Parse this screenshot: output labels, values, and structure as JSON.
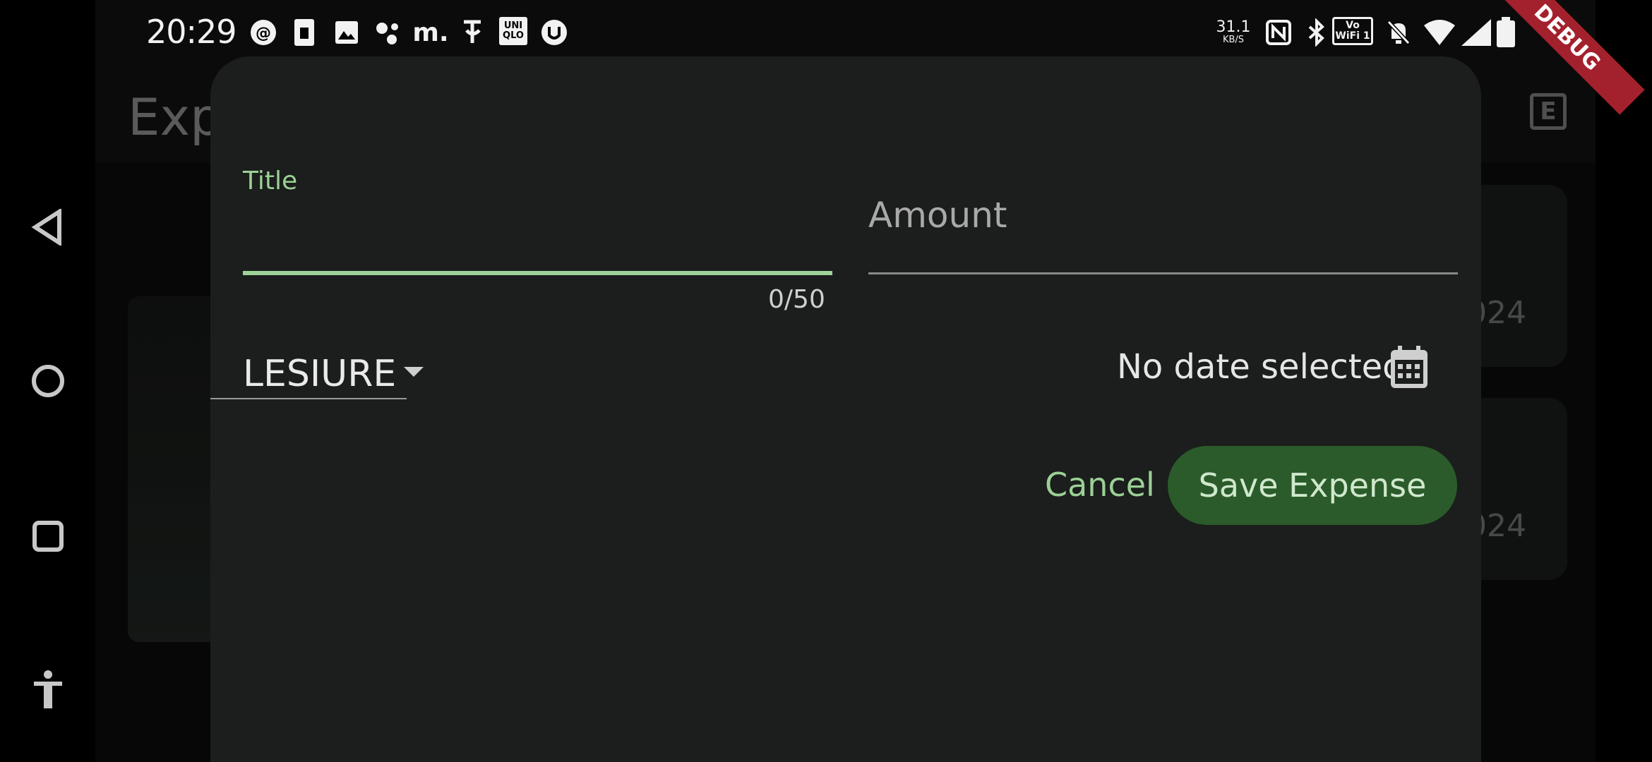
{
  "status_bar": {
    "time": "20:29",
    "net_speed_value": "31.1",
    "net_speed_unit": "KB/S",
    "m_app_label": "m.",
    "uniqlo_label": "UNI QLO",
    "vowifi_label": "Vo WiFi 1",
    "left_icons": [
      "threads-icon",
      "sim-card-icon",
      "image-icon",
      "assistant-icon",
      "m-app-icon",
      "phonepe-icon",
      "uniqlo-icon",
      "notification-app-icon"
    ],
    "right_icons": [
      "net-speed-indicator",
      "nfc-icon",
      "bluetooth-icon",
      "vowifi-icon",
      "mute-icon",
      "wifi-icon",
      "signal-icon",
      "battery-icon"
    ]
  },
  "nav_bar": {
    "icons": [
      "back-icon",
      "home-icon",
      "recents-icon",
      "accessibility-icon"
    ]
  },
  "background_app": {
    "title": "Exp",
    "action_label": "E",
    "card_date_1": "024",
    "card_date_2": "024"
  },
  "sheet": {
    "title_label": "Title",
    "title_value": "",
    "title_counter": "0/50",
    "amount_placeholder": "Amount",
    "category_selected": "LESIURE",
    "date_text": "No date selected",
    "cancel_label": "Cancel",
    "save_label": "Save Expense"
  },
  "debug_banner": "DEBUG",
  "colors": {
    "accent": "#9ed49a",
    "sheet_bg": "#1b1e1c",
    "save_button_bg": "#2b5b2a",
    "debug_ribbon": "#a3212c"
  }
}
